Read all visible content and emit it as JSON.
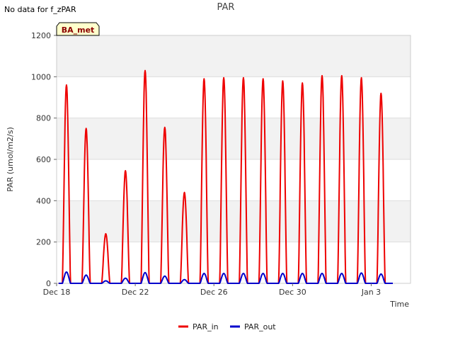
{
  "page": {
    "no_data_note": "No data for f_zPAR"
  },
  "chart_data": {
    "type": "line",
    "title": "PAR",
    "xlabel": "Time",
    "ylabel": "PAR (umol/m2/s)",
    "site_tag": "BA_met",
    "x_ticks": [
      "Dec 18",
      "Dec 22",
      "Dec 26",
      "Dec 30",
      "Jan 3"
    ],
    "x_tick_days": [
      0,
      4,
      8,
      12,
      16
    ],
    "xlim_days": [
      0,
      18
    ],
    "ylim": [
      0,
      1200
    ],
    "y_ticks": [
      0,
      200,
      400,
      600,
      800,
      1000,
      1200
    ],
    "grid": true,
    "alternating_bands": true,
    "legend_position": "bottom-center",
    "colors": {
      "PAR_in": "#ee0000",
      "PAR_out": "#0000cc",
      "band": "#f2f2f2",
      "tag_bg": "#ffffcc"
    },
    "series": [
      {
        "name": "PAR_in",
        "daily_peaks": [
          {
            "day": "Dec 18",
            "peak": 960
          },
          {
            "day": "Dec 19",
            "peak": 750
          },
          {
            "day": "Dec 20",
            "peak": 240
          },
          {
            "day": "Dec 21",
            "peak": 545
          },
          {
            "day": "Dec 22",
            "peak": 1030
          },
          {
            "day": "Dec 23",
            "peak": 755
          },
          {
            "day": "Dec 24",
            "peak": 440
          },
          {
            "day": "Dec 25",
            "peak": 990
          },
          {
            "day": "Dec 26",
            "peak": 995
          },
          {
            "day": "Dec 27",
            "peak": 995
          },
          {
            "day": "Dec 28",
            "peak": 990
          },
          {
            "day": "Dec 29",
            "peak": 980
          },
          {
            "day": "Dec 30",
            "peak": 970
          },
          {
            "day": "Dec 31",
            "peak": 1005
          },
          {
            "day": "Jan 1",
            "peak": 1005
          },
          {
            "day": "Jan 2",
            "peak": 995
          },
          {
            "day": "Jan 3",
            "peak": 920
          }
        ]
      },
      {
        "name": "PAR_out",
        "daily_peaks": [
          {
            "day": "Dec 18",
            "peak": 55
          },
          {
            "day": "Dec 19",
            "peak": 40
          },
          {
            "day": "Dec 20",
            "peak": 12
          },
          {
            "day": "Dec 21",
            "peak": 25
          },
          {
            "day": "Dec 22",
            "peak": 52
          },
          {
            "day": "Dec 23",
            "peak": 35
          },
          {
            "day": "Dec 24",
            "peak": 18
          },
          {
            "day": "Dec 25",
            "peak": 48
          },
          {
            "day": "Dec 26",
            "peak": 48
          },
          {
            "day": "Dec 27",
            "peak": 48
          },
          {
            "day": "Dec 28",
            "peak": 48
          },
          {
            "day": "Dec 29",
            "peak": 48
          },
          {
            "day": "Dec 30",
            "peak": 48
          },
          {
            "day": "Dec 31",
            "peak": 48
          },
          {
            "day": "Jan 1",
            "peak": 48
          },
          {
            "day": "Jan 2",
            "peak": 50
          },
          {
            "day": "Jan 3",
            "peak": 45
          }
        ]
      }
    ]
  }
}
